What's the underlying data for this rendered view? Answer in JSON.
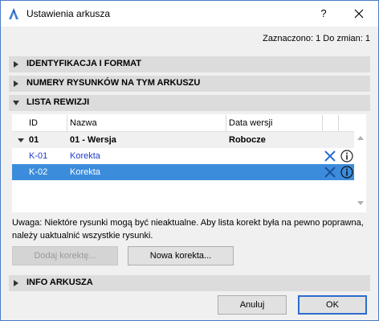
{
  "window": {
    "title": "Ustawienia arkusza",
    "help": "?",
    "close_icon": "close-icon",
    "app_icon": "archicad-icon"
  },
  "summary": "Zaznaczono: 1 Do zmian: 1",
  "sections": {
    "identification": "IDENTYFIKACJA I FORMAT",
    "drawing_numbers": "NUMERY RYSUNKÓW NA TYM ARKUSZU",
    "revision_list": "LISTA REWIZJI",
    "sheet_info": "INFO ARKUSZA"
  },
  "table": {
    "headers": {
      "id": "ID",
      "name": "Nazwa",
      "date": "Data wersji"
    },
    "group": {
      "id": "01",
      "name": "01 - Wersja",
      "date": "Robocze"
    },
    "rows": [
      {
        "id": "K-01",
        "name": "Korekta",
        "selected": false
      },
      {
        "id": "K-02",
        "name": "Korekta",
        "selected": true
      }
    ]
  },
  "warning": "Uwaga: Niektóre rysunki mogą być nieaktualne. Aby lista korekt była na pewno poprawna, należy uaktualnić wszystkie rysunki.",
  "buttons": {
    "add_correction": "Dodaj korektę...",
    "new_correction": "Nowa korekta...",
    "cancel": "Anuluj",
    "ok": "OK"
  },
  "colors": {
    "selection": "#3c8cdc",
    "link": "#1c3ccc",
    "accent": "#2c6ccc"
  }
}
